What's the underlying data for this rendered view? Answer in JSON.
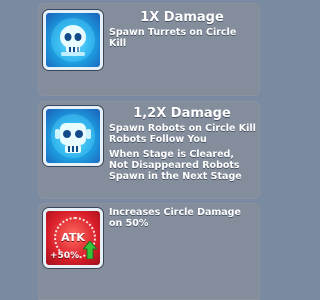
{
  "upgrades": [
    {
      "title": "1X Damage",
      "description": "Spawn Turrets on Circle Kill",
      "icon": "turret-skull-icon"
    },
    {
      "title": "1,2X Damage",
      "description": "Spawn Robots on Circle Kill Robots Follow You",
      "note": "When Stage is Cleared, Not Disappeared Robots Spawn in the Next Stage",
      "icon": "robot-skull-icon"
    },
    {
      "description": "Increases Circle Damage on 50%",
      "icon": "atk-boost-icon",
      "badge_label": "ATK",
      "badge_value": "+50%"
    }
  ],
  "colors": {
    "background": "#7a8aa0",
    "card": "#848d9b",
    "icon_blue": "#1ea6e6",
    "icon_red": "#d81e2a",
    "arrow_green": "#37c23a"
  }
}
